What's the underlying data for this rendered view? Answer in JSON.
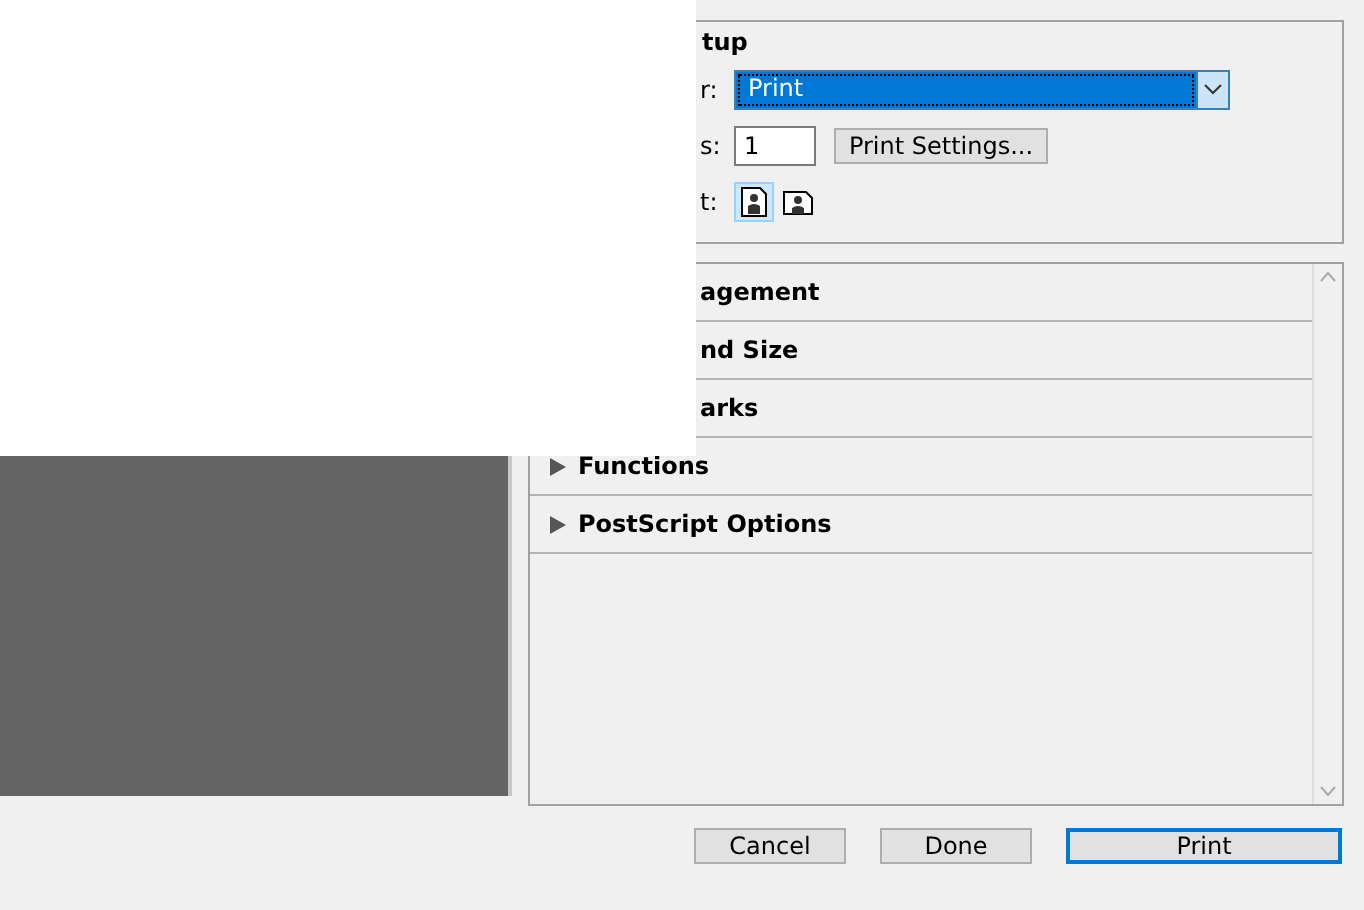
{
  "setup": {
    "title": "tup",
    "printer_label": "r:",
    "printer_value": "Print",
    "copies_label": "s:",
    "copies_value": "1",
    "settings_button": "Print Settings...",
    "layout_label": "t:",
    "layout_options": [
      {
        "kind": "portrait",
        "selected": true
      },
      {
        "kind": "landscape",
        "selected": false
      }
    ]
  },
  "sections": [
    {
      "label": "agement",
      "kind": "covered"
    },
    {
      "label": "nd Size",
      "kind": "covered"
    },
    {
      "label": "arks",
      "kind": "covered"
    },
    {
      "label": "Functions",
      "kind": "full"
    },
    {
      "label": "PostScript Options",
      "kind": "full"
    }
  ],
  "buttons": [
    {
      "label": "Cancel",
      "kind": "normal"
    },
    {
      "label": "Done",
      "kind": "normal"
    },
    {
      "label": "Print",
      "kind": "default"
    }
  ]
}
